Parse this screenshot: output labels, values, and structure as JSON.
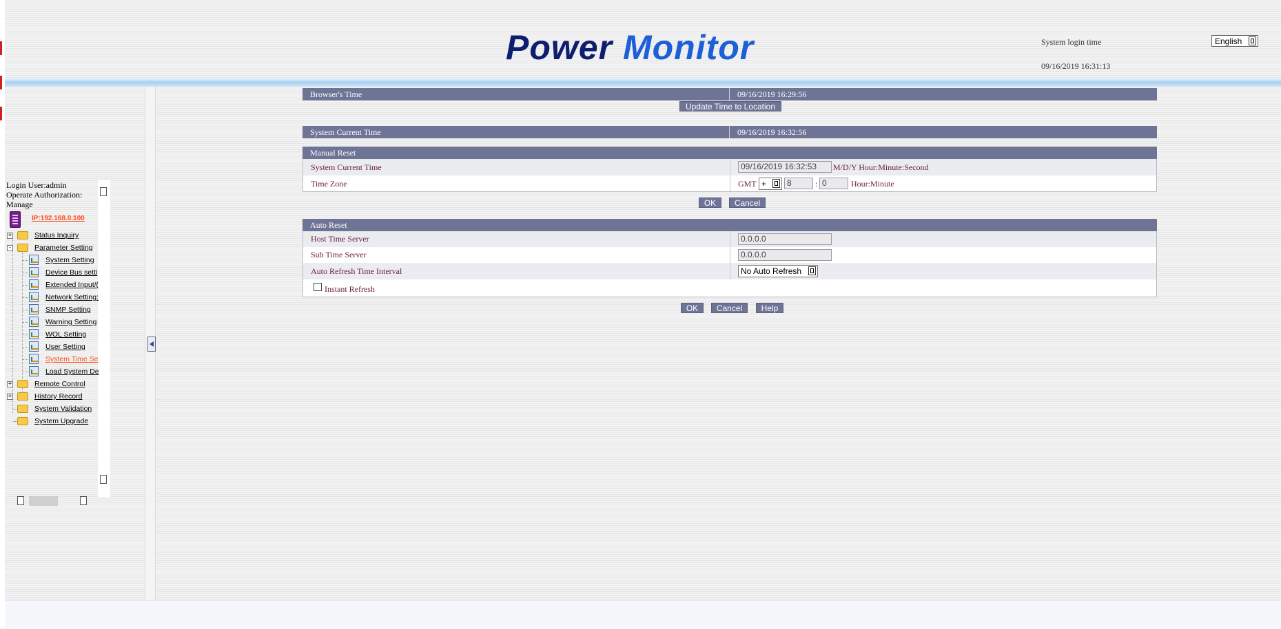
{
  "header": {
    "logo_word1": "Power",
    "logo_word2": "Monitor",
    "login_label": "System login time",
    "login_time": "09/16/2019 16:31:13",
    "language": "English"
  },
  "sidebar": {
    "login_user": "Login User:admin",
    "auth_line1": "Operate Authorization:",
    "auth_line2": "Manage",
    "ip": "IP:192.168.0.100",
    "tree": [
      {
        "label": "Status Inquiry",
        "level": 0,
        "expander": "+",
        "icon": "folder"
      },
      {
        "label": "Parameter Setting",
        "level": 0,
        "expander": "-",
        "icon": "folder"
      },
      {
        "label": "System Setting",
        "level": 1,
        "icon": "page"
      },
      {
        "label": "Device Bus setti",
        "level": 1,
        "icon": "page"
      },
      {
        "label": "Extended Input/(",
        "level": 1,
        "icon": "page"
      },
      {
        "label": "Network Setting:",
        "level": 1,
        "icon": "page"
      },
      {
        "label": "SNMP Setting",
        "level": 1,
        "icon": "page"
      },
      {
        "label": "Warning Setting",
        "level": 1,
        "icon": "page"
      },
      {
        "label": "WOL Setting",
        "level": 1,
        "icon": "page"
      },
      {
        "label": "User Setting",
        "level": 1,
        "icon": "page"
      },
      {
        "label": "System Time Se",
        "level": 1,
        "icon": "page",
        "active": true
      },
      {
        "label": "Load System De",
        "level": 1,
        "icon": "page"
      },
      {
        "label": "Remote Control",
        "level": 0,
        "expander": "+",
        "icon": "folder"
      },
      {
        "label": "History Record",
        "level": 0,
        "expander": "+",
        "icon": "folder"
      },
      {
        "label": "System Validation",
        "level": 0,
        "icon": "folder"
      },
      {
        "label": "System Upgrade",
        "level": 0,
        "icon": "folder"
      }
    ]
  },
  "browser_time": {
    "label": "Browser's Time",
    "value": "09/16/2019 16:29:56",
    "update_button": "Update Time to Location"
  },
  "system_time": {
    "label": "System Current Time",
    "value": "09/16/2019 16:32:56"
  },
  "manual_reset": {
    "title": "Manual Reset",
    "current_time_label": "System Current Time",
    "current_time_value": "09/16/2019 16:32:53",
    "current_time_format": "M/D/Y Hour:Minute:Second",
    "timezone_label": "Time Zone",
    "gmt": "GMT",
    "sign": "+",
    "hour": "8",
    "colon": ":",
    "minute": "0",
    "timezone_format": "Hour:Minute",
    "ok": "OK",
    "cancel": "Cancel"
  },
  "auto_reset": {
    "title": "Auto Reset",
    "host_label": "Host Time Server",
    "host_value": "0.0.0.0",
    "sub_label": "Sub Time Server",
    "sub_value": "0.0.0.0",
    "interval_label": "Auto Refresh Time Interval",
    "interval_value": "No Auto Refresh",
    "instant_refresh": "Instant Refresh",
    "ok": "OK",
    "cancel": "Cancel",
    "help": "Help"
  },
  "colors": {
    "header_bar": "#6e7496",
    "active_link": "#ff4a1a",
    "label_text": "#6a1e3a"
  }
}
